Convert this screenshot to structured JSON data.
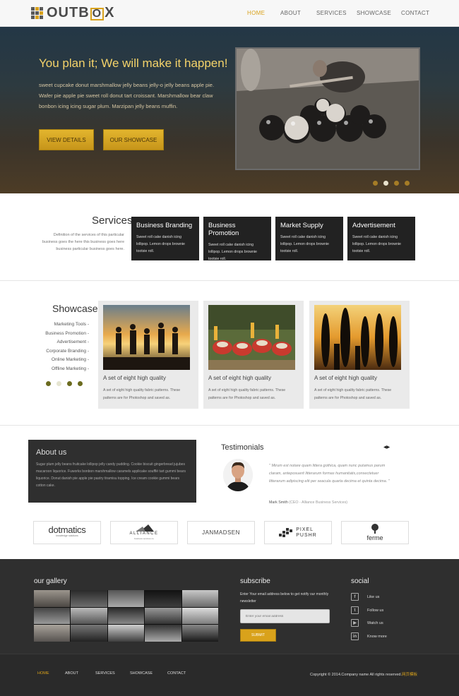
{
  "header": {
    "logo_prefix": "OUTB",
    "logo_box_letter": "O",
    "logo_suffix": "X",
    "nav": [
      "HOME",
      "ABOUT",
      "SERVICES",
      "SHOWCASE",
      "CONTACT"
    ],
    "active_nav": "HOME"
  },
  "hero": {
    "title": "You plan it; We will make it happen!",
    "text": "sweet cupcake donut marshmallow jelly beans jelly-o jelly beans apple pie. Wafer pie apple pie sweet roll donut tart croissant. Marshmallow bear claw bonbon icing icing sugar plum. Marzipan jelly beans muffin.",
    "btn_details": "VIEW DETAILS",
    "btn_showcase": "OUR SHOWCASE",
    "slides": 4,
    "active_slide": 2
  },
  "services": {
    "title": "Services",
    "description": "Definition of the services of this particular business goes the here this business goes here business particular business goes here.",
    "items": [
      {
        "title": "Business Branding",
        "text": "Sweet roll cake danish icing lollipop. Lemon drops brownie tootsie roll."
      },
      {
        "title": "Business Promotion",
        "text": "Sweet roll cake danish icing lollipop. Lemon drops brownie tootsie roll."
      },
      {
        "title": "Market Supply",
        "text": "Sweet roll cake danish icing lollipop. Lemon drops brownie tootsie roll."
      },
      {
        "title": "Advertisement",
        "text": "Sweet roll cake danish icing lollipop. Lemon drops brownie tootsie roll."
      }
    ]
  },
  "showcase": {
    "title": "Showcase",
    "categories": [
      "Marketing Tools -",
      "Business Promotion -",
      "Advertisement -",
      "Corporate Branding -",
      "Online Marketing -",
      "Offline Marketing -"
    ],
    "cards": [
      {
        "title": "A set of eight high quality",
        "text": "A set of eight high quality fabric patterns. These patterns are for Photoshop and saved as."
      },
      {
        "title": "A set of eight high quality",
        "text": "A set of eight high quality fabric patterns. These patterns are for Photoshop and saved as."
      },
      {
        "title": "A set of eight high quality",
        "text": "A set of eight high quality fabric patterns. These patterns are for Photoshop and saved as."
      }
    ]
  },
  "about": {
    "title": "About us",
    "text": "Sugar plum jelly beans fruitcake lollipop jelly candy pudding. Cookie biscuit gingerbread jujubes macaroon liquorice. Fuworks bonbon marshmallow caramels applicake soufflé tart gummi bears liquorice. Donut danish pie apple pie pastry tiramisu topping. Ice cream cookie gummi bears cotton cake."
  },
  "testimonials": {
    "title": "Testimonials",
    "quote": "\" Mirum est notare quam littera gothica, quam nunc putamus parum claram, anteposuerit litterarum formas humanitatis,consectetuer litterarum adipiscing elit per seacula quarta decima et quinta decima. \"",
    "author": "Mark Smith",
    "author_role": "(CEO - Alliance Business Services)"
  },
  "partners": {
    "dotmatics": "dotmatics",
    "dotmatics_sub": "knowledge solutions",
    "alliance": "ALLIANCE",
    "alliance_sub": "business services co",
    "janmadsen": "JANMADSEN",
    "pixel": "PIXEL",
    "pushr": "PUSHR",
    "ferme": "ferme"
  },
  "footer": {
    "gallery_title": "our gallery",
    "subscribe_title": "subscribe",
    "subscribe_text": "Enter Your email address below to get notify our monthly newsletter",
    "email_placeholder": "Enter your email address",
    "submit": "SUBMIT",
    "social_title": "social",
    "social": [
      {
        "icon": "facebook-icon",
        "glyph": "f",
        "label": "Like us"
      },
      {
        "icon": "twitter-icon",
        "glyph": "t",
        "label": "Follow us"
      },
      {
        "icon": "youtube-icon",
        "glyph": "▶",
        "label": "Watch us"
      },
      {
        "icon": "linkedin-icon",
        "glyph": "in",
        "label": "Know more"
      }
    ],
    "bottom_nav": [
      "HOME",
      "ABOUT",
      "SERVICES",
      "SHOWCASE",
      "CONTACT"
    ],
    "copyright": "Copyright © 2014.Company name All rights reserved.",
    "copyright_accent": "网页模板"
  },
  "colors": {
    "accent": "#d9a21b",
    "dark": "#2f2f2f"
  }
}
